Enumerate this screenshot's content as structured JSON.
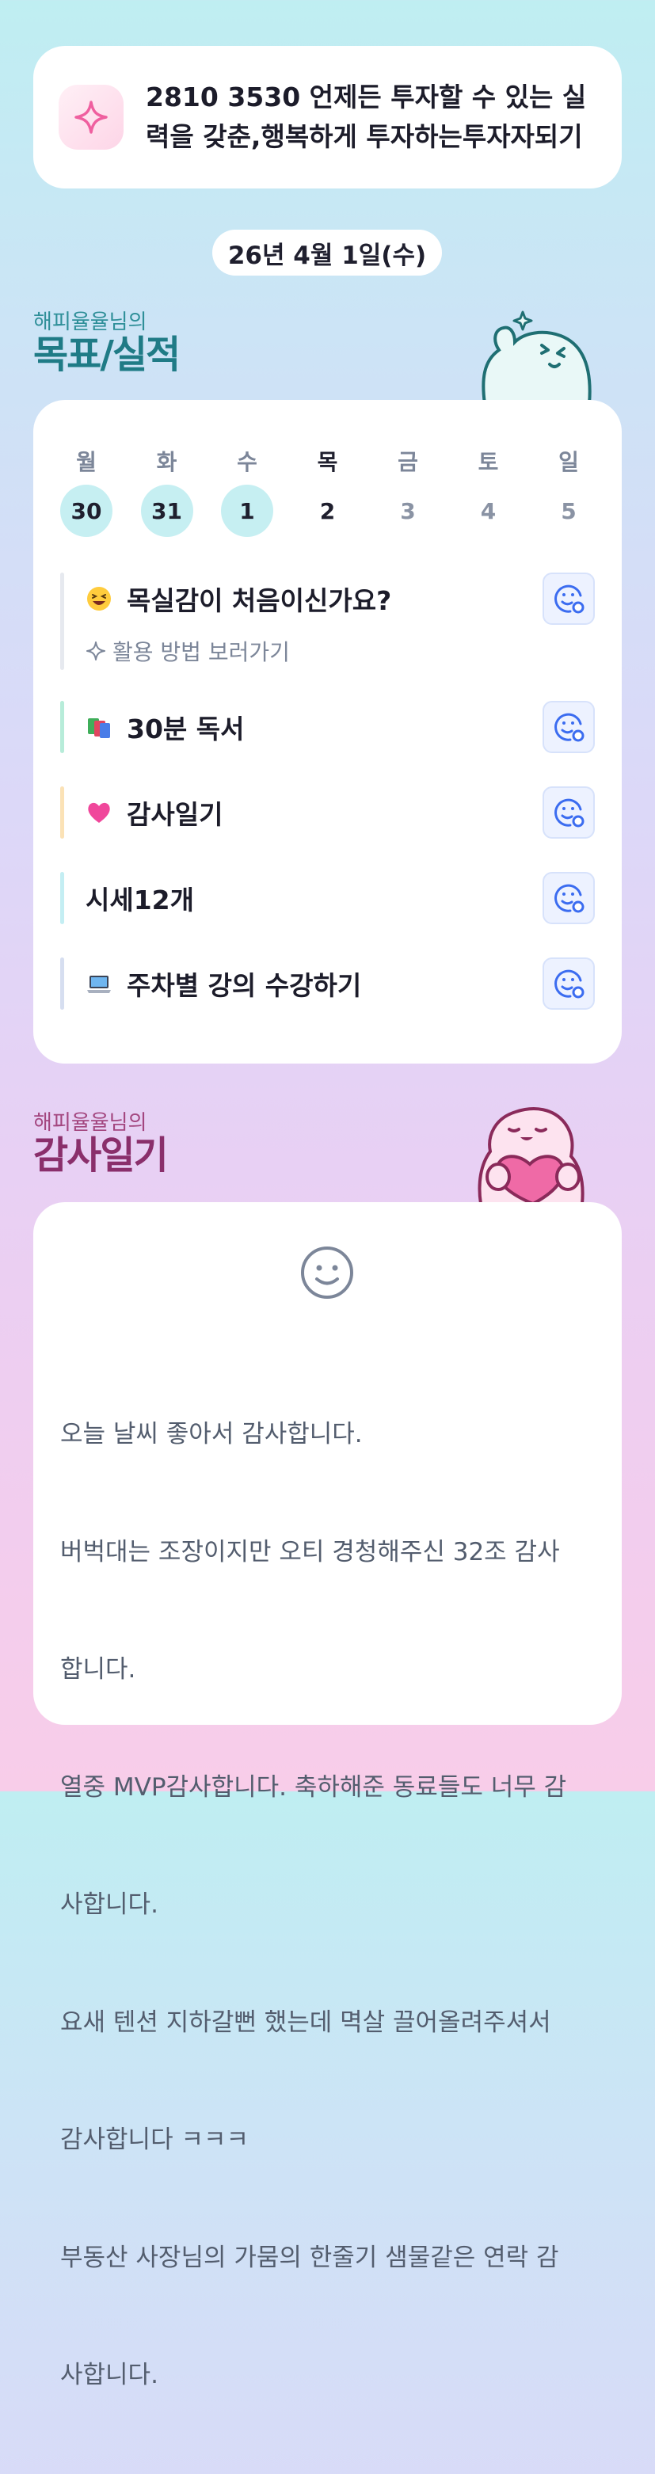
{
  "goal": {
    "icon": "sparkle-icon",
    "text": "2810 3530 언제든 투자할 수 있는 실력을 갖춘,행복하게 투자하는투자자되기"
  },
  "date_label": "26년 4월 1일(수)",
  "goals_section": {
    "subtitle": "해피율율님의",
    "title": "목표/실적"
  },
  "week": [
    {
      "day": "월",
      "date": "30",
      "state": "done"
    },
    {
      "day": "화",
      "date": "31",
      "state": "done"
    },
    {
      "day": "수",
      "date": "1",
      "state": "done"
    },
    {
      "day": "목",
      "date": "2",
      "state": "today"
    },
    {
      "day": "금",
      "date": "3",
      "state": "future"
    },
    {
      "day": "토",
      "date": "4",
      "state": "future"
    },
    {
      "day": "일",
      "date": "5",
      "state": "future"
    }
  ],
  "tasks": [
    {
      "emoji": "grinning-squint-emoji",
      "label": "목실감이 처음이신가요?",
      "bar_color": "#e6e9ef",
      "link": "활용 방법 보러가기"
    },
    {
      "emoji": "books-emoji",
      "label": "30분 독서",
      "bar_color": "#b7ecd9"
    },
    {
      "emoji": "pink-heart-emoji",
      "label": "감사일기",
      "bar_color": "#fbe2b6"
    },
    {
      "emoji": "",
      "label": "시세12개",
      "bar_color": "#c4eef3"
    },
    {
      "emoji": "laptop-emoji",
      "label": "주차별 강의 수강하기",
      "bar_color": "#d6def0"
    }
  ],
  "diary_section": {
    "subtitle": "해피율율님의",
    "title": "감사일기"
  },
  "diary": {
    "mood_icon": "smiley-face-icon",
    "lines": [
      "오늘 날씨 좋아서 감사합니다.",
      "버벅대는 조장이지만 오티 경청해주신 32조 감사",
      "합니다.",
      "열중 MVP감사합니다. 축하해준 동료들도 너무 감",
      "사합니다.",
      "요새 텐션 지하갈뻔 했는데 멱살 끌어올려주셔서",
      "감사합니다 ㅋㅋㅋ",
      "부동산 사장님의 가뭄의 한줄기 샘물같은 연락 감",
      "사합니다."
    ]
  },
  "colors": {
    "goal_title": "#1f7b86",
    "diary_title": "#8a2f6b",
    "check_blue": "#3b6cf0"
  }
}
